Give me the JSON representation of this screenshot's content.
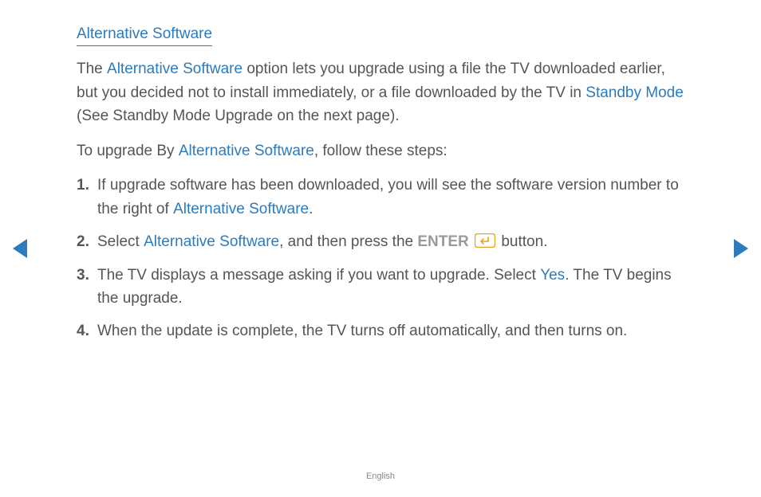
{
  "heading": "Alternative Software",
  "intro": {
    "t1": "The ",
    "kw1": "Alternative Software",
    "t2": " option lets you upgrade using a file the TV downloaded earlier, but you decided not to install immediately, or a file downloaded by the TV in ",
    "kw2": "Standby Mode",
    "t3": " (See Standby Mode Upgrade on the next page)."
  },
  "lead": {
    "t1": "To upgrade By ",
    "kw1": "Alternative Software",
    "t2": ", follow these steps:"
  },
  "steps": {
    "s1": {
      "t1": "If upgrade software has been downloaded, you will see the software version number to the right of ",
      "kw1": "Alternative Software",
      "t2": "."
    },
    "s2": {
      "t1": "Select ",
      "kw1": "Alternative Software",
      "t2": ", and then press the ",
      "kw2": "ENTER",
      "t3": " button."
    },
    "s3": {
      "t1": "The TV displays a message asking if you want to upgrade. Select ",
      "kw1": "Yes",
      "t2": ". The TV begins the upgrade."
    },
    "s4": {
      "t1": "When the update is complete, the TV turns off automatically, and then turns on."
    }
  },
  "footer": "English"
}
